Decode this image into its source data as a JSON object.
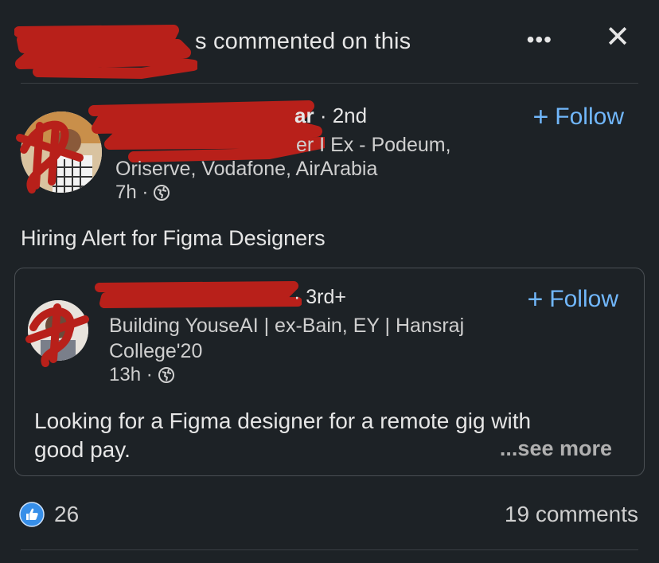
{
  "header": {
    "title_suffix": "s commented on this",
    "more_icon": "more-horizontal-icon",
    "close_icon": "close-icon",
    "more_label": "•••",
    "close_label": "✕"
  },
  "post": {
    "author_name_tail": "ar",
    "degree": "· 2nd",
    "headline_line1": "er I Ex - Podeum,",
    "headline_line2": "Oriserve, Vodafone, AirArabia",
    "time": "7h ·",
    "follow_label": "Follow",
    "body": "Hiring Alert for Figma Designers"
  },
  "shared_post": {
    "degree": "· 3rd+",
    "headline_line1": "Building YouseAI | ex-Bain, EY | Hansraj",
    "headline_line2": "College'20",
    "time": "13h ·",
    "follow_label": "Follow",
    "body_line1": "Looking for a Figma designer for a remote gig with",
    "body_line2": "good pay.",
    "see_more": "...see more"
  },
  "footer": {
    "likes": "26",
    "comments": "19 comments"
  },
  "colors": {
    "background": "#1d2226",
    "accent": "#71b7fb",
    "redaction": "#b8201a",
    "like_blue": "#378fe9"
  }
}
